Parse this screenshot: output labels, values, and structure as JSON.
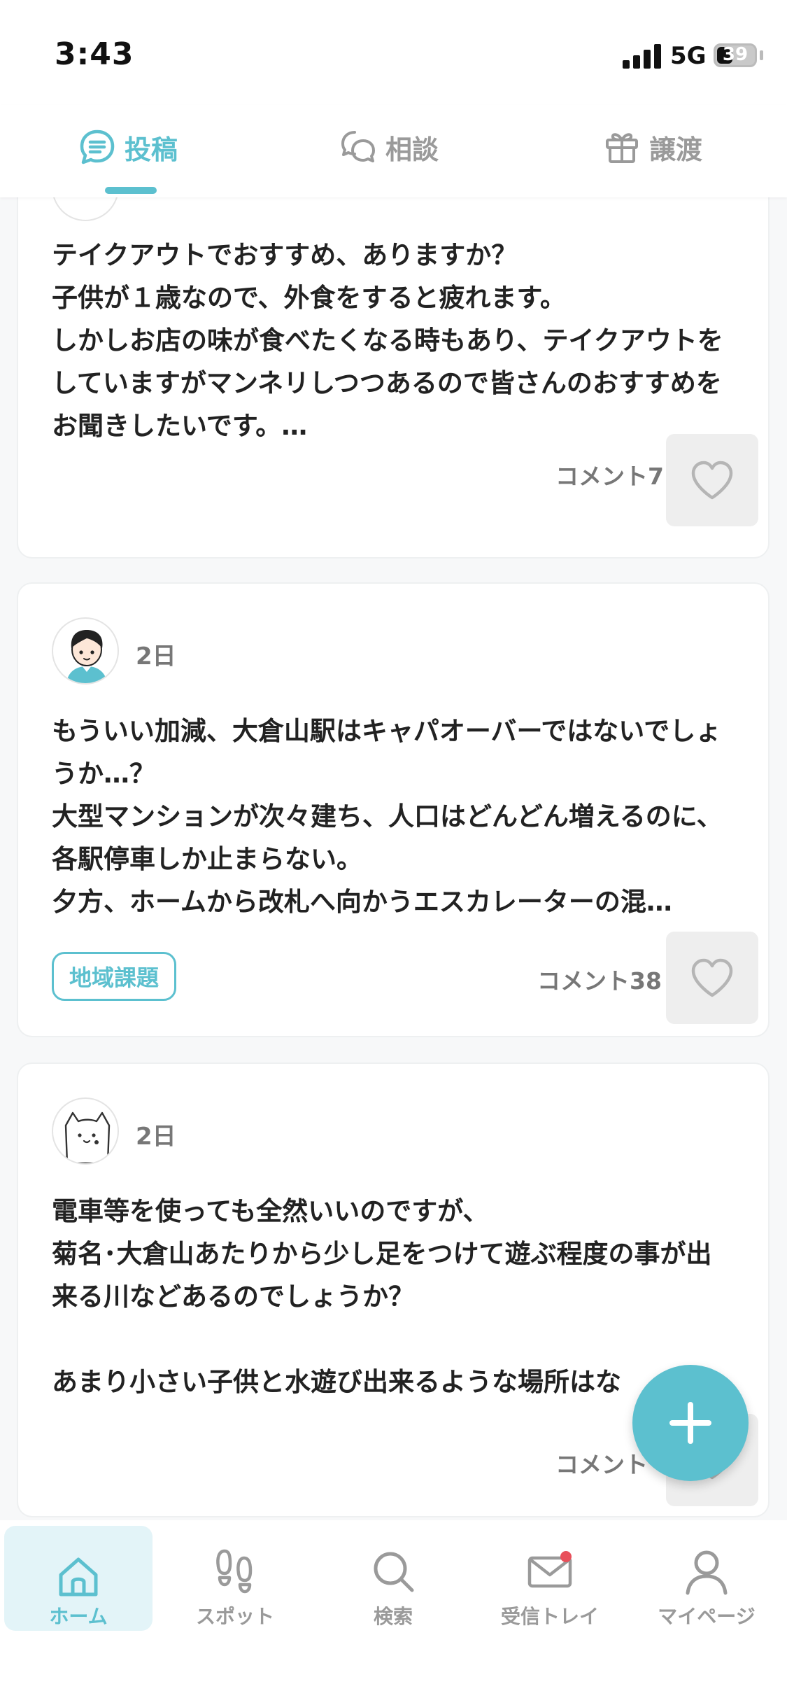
{
  "status_bar": {
    "time": "3:43",
    "network": "5G",
    "battery": "39"
  },
  "tabs": [
    {
      "label": "投稿",
      "icon": "chat-lines-icon",
      "active": true
    },
    {
      "label": "相談",
      "icon": "chat-bubbles-icon",
      "active": false
    },
    {
      "label": "譲渡",
      "icon": "gift-icon",
      "active": false
    }
  ],
  "posts": [
    {
      "text": "テイクアウトでおすすめ、ありますか？\n子供が１歳なので、外食をすると疲れます。\nしかしお店の味が食べたくなる時もあり、テイクアウトをしていますがマンネリしつつあるので皆さんのおすすめをお聞きしたいです。…",
      "comments": "コメント7"
    },
    {
      "age": "2日",
      "avatar": "boy-avatar-icon",
      "text": "もういい加減、大倉山駅はキャパオーバーではないでしょうか…？\n大型マンションが次々建ち、人口はどんどん増えるのに、各駅停車しか止まらない。\n夕方、ホームから改札へ向かうエスカレーターの混…",
      "tag": "地域課題",
      "comments": "コメント38"
    },
    {
      "age": "2日",
      "avatar": "cat-avatar-icon",
      "text": "電車等を使っても全然いいのですが、\n菊名･大倉山あたりから少し足をつけて遊ぶ程度の事が出来る川などあるのでしょうか？\n\nあまり小さい子供と水遊び出来るような場所はな",
      "comments": "コメント"
    }
  ],
  "bottom_nav": [
    {
      "label": "ホーム",
      "icon": "home-icon",
      "active": true
    },
    {
      "label": "スポット",
      "icon": "footprints-icon",
      "active": false
    },
    {
      "label": "検索",
      "icon": "search-icon",
      "active": false
    },
    {
      "label": "受信トレイ",
      "icon": "mail-icon",
      "active": false,
      "badge": true
    },
    {
      "label": "マイページ",
      "icon": "person-icon",
      "active": false
    }
  ],
  "colors": {
    "accent": "#5cc0cf",
    "inactive": "#9a9a9a",
    "badge": "#e8505b"
  }
}
